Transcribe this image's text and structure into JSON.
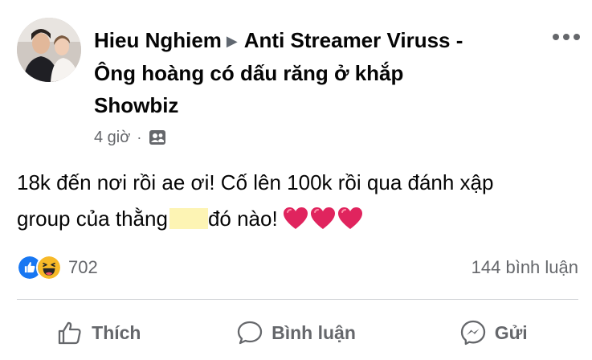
{
  "post": {
    "author": "Hieu Nghiem",
    "group_line_1": "Anti Streamer Viruss -",
    "group_line_2": "Ông hoàng có dấu răng ở khắp",
    "group_line_3": "Showbiz",
    "time": "4 giờ",
    "dot": "·",
    "text_part_1": "18k đến nơi rồi ae ơi! Cố lên 100k rồi qua đánh xập",
    "text_part_2": "group của thằng",
    "text_part_3": "đó nào!",
    "hearts_count": 3
  },
  "stats": {
    "reaction_count": "702",
    "comments": "144 bình luận"
  },
  "actions": {
    "like": "Thích",
    "comment": "Bình luận",
    "send": "Gửi"
  },
  "icons": {
    "privacy": "group-members-icon",
    "like_reaction": "like-reaction-icon",
    "haha_reaction": "haha-reaction-icon",
    "heart": "red-heart-emoji",
    "like": "thumbs-up-outline-icon",
    "comment": "comment-bubble-icon",
    "send": "messenger-icon"
  },
  "colors": {
    "like_blue": "#1877f2",
    "haha_yellow": "#f7b928",
    "heart_red": "#e0245e",
    "muted": "#65676b",
    "censor_highlight": "#fdf4b4"
  }
}
